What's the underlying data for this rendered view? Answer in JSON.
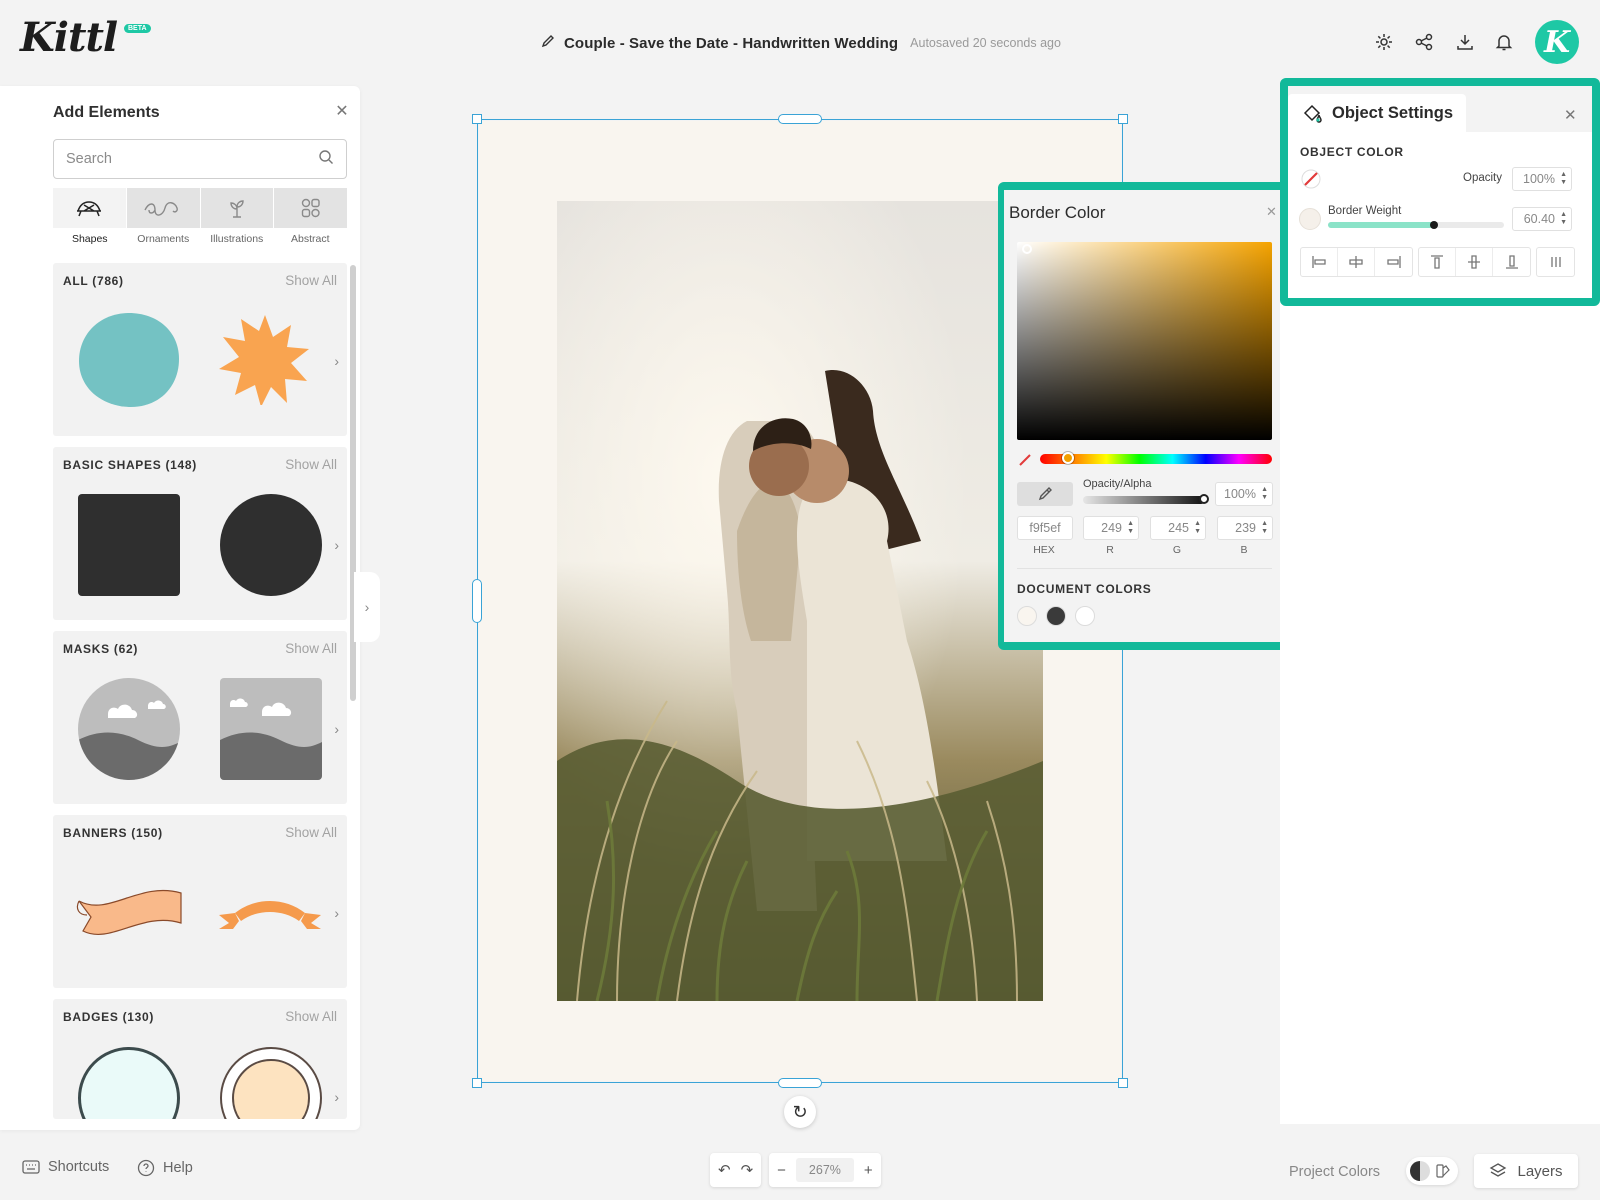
{
  "app": {
    "logo_text": "Kittl",
    "logo_badge": "BETA"
  },
  "header": {
    "doc_title": "Couple - Save the Date - Handwritten Wedding",
    "autosave": "Autosaved 20 seconds ago",
    "avatar_letter": "K",
    "icons": [
      "gear-icon",
      "share-icon",
      "download-icon",
      "bell-icon"
    ]
  },
  "add_elements": {
    "title": "Add Elements",
    "search_placeholder": "Search",
    "tabs": [
      {
        "label": "Shapes",
        "active": true
      },
      {
        "label": "Ornaments",
        "active": false
      },
      {
        "label": "Illustrations",
        "active": false
      },
      {
        "label": "Abstract",
        "active": false
      }
    ],
    "sections": [
      {
        "title": "ALL (786)",
        "action": "Show All"
      },
      {
        "title": "BASIC SHAPES (148)",
        "action": "Show All"
      },
      {
        "title": "MASKS (62)",
        "action": "Show All"
      },
      {
        "title": "BANNERS (150)",
        "action": "Show All"
      },
      {
        "title": "BADGES (130)",
        "action": "Show All"
      }
    ]
  },
  "border_color": {
    "title": "Border Color",
    "alpha_label": "Opacity/Alpha",
    "alpha_value": "100%",
    "hex": "f9f5ef",
    "r": "249",
    "g": "245",
    "b": "239",
    "labels": {
      "hex": "HEX",
      "r": "R",
      "g": "G",
      "b": "B"
    },
    "doc_colors_title": "DOCUMENT COLORS",
    "doc_colors": [
      "#f9f5ef",
      "#3a3a3a",
      "#ffffff"
    ],
    "picker_hue": "#f5a300"
  },
  "object_settings": {
    "tab_label": "Object Settings",
    "section": "OBJECT COLOR",
    "opacity_label": "Opacity",
    "opacity_value": "100%",
    "border_weight_label": "Border Weight",
    "border_weight_value": "60.40",
    "border_weight_fraction": 0.6
  },
  "footer": {
    "shortcuts": "Shortcuts",
    "help": "Help",
    "zoom": "267%",
    "project_colors": "Project Colors",
    "layers": "Layers"
  },
  "colors": {
    "accent": "#12b99a",
    "selection": "#3aa3d6"
  }
}
